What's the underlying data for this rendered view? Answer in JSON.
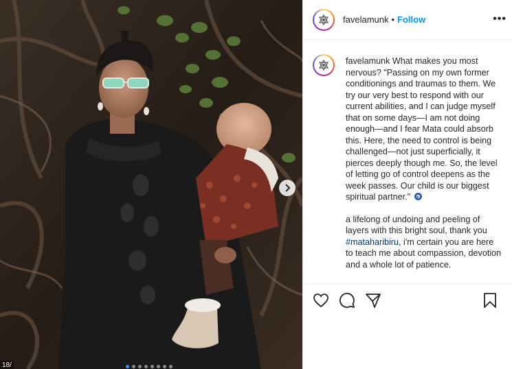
{
  "post": {
    "username": "favelamunk",
    "separator": "•",
    "follow_label": "Follow",
    "more_label": "•••",
    "counter": "18/",
    "carousel": {
      "total_dots": 8,
      "active_index": 0
    },
    "caption": {
      "username": "favelamunk",
      "part1": "What makes you most nervous? \"Passing on my own former conditionings and traumas to them. We try our very best to respond with our current abilities, and I can judge myself that on some days—I am not doing enough—and I fear Mata could absorb this. Here, the need to control is being challenged—not just superficially, it pierces deeply though me. So, the level of letting go of control deepens as the week passes. Our child is our biggest spiritual partner.\"",
      "part2_before": "a lifelong of undoing and peeling of layers with this bright soul, thank you",
      "hashtag": "#mataharibiru",
      "part2_after": ", i'm certain you are here to teach me about compassion, devotion and a whole lot of patience."
    }
  },
  "icons": {
    "like": "heart-icon",
    "comment": "comment-icon",
    "share": "share-icon",
    "save": "bookmark-icon",
    "next": "chevron-right-icon",
    "avatar": "seal-logo-icon"
  },
  "colors": {
    "follow": "#0095f6",
    "hashtag": "#00376b",
    "active_dot": "#3897f0"
  }
}
